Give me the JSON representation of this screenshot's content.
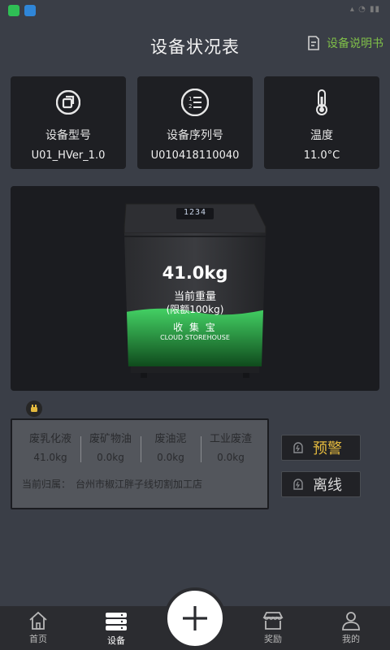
{
  "header": {
    "title": "设备状况表",
    "manual_link": "设备说明书"
  },
  "info_cards": [
    {
      "icon": "device-model-icon",
      "label": "设备型号",
      "value": "U01_HVer_1.0"
    },
    {
      "icon": "serial-list-icon",
      "label": "设备序列号",
      "value": "U010418110040"
    },
    {
      "icon": "thermometer-icon",
      "label": "温度",
      "value": "11.0°C"
    }
  ],
  "device": {
    "display_value": "1234",
    "weight": "41.0kg",
    "weight_label": "当前重量",
    "limit": "(限额100kg)",
    "brand_cn": "收 集 宝",
    "brand_en": "CLOUD STOREHOUSE",
    "fill_percent": 41
  },
  "waste": [
    {
      "label": "废乳化液",
      "value": "41.0kg"
    },
    {
      "label": "废矿物油",
      "value": "0.0kg"
    },
    {
      "label": "废油泥",
      "value": "0.0kg"
    },
    {
      "label": "工业废渣",
      "value": "0.0kg"
    }
  ],
  "owner": {
    "label": "当前归属：",
    "value": "台州市椒江胖子线切割加工店"
  },
  "buttons": {
    "warning": "预警",
    "offline": "离线"
  },
  "tabs": [
    {
      "label": "首页"
    },
    {
      "label": "设备"
    },
    {
      "label": "奖励"
    },
    {
      "label": "我的"
    }
  ],
  "colors": {
    "accent_green": "#7fbf48",
    "warning_gold": "#e3b93e",
    "bin_fill": "#3cc25a"
  }
}
